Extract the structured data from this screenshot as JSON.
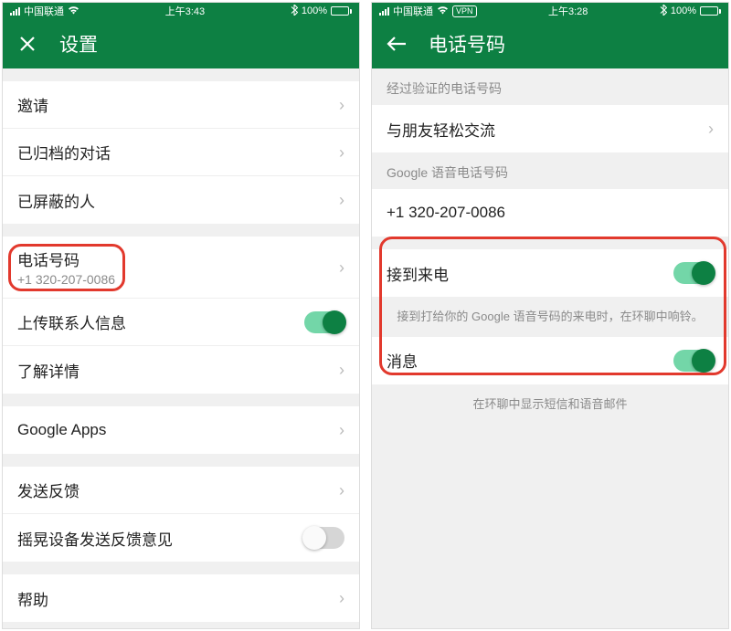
{
  "left": {
    "status": {
      "carrier": "中国联通",
      "time": "上午3:43",
      "bluetooth": "✱",
      "battery_pct": "100%"
    },
    "title": "设置",
    "items": {
      "invite": "邀请",
      "archived": "已归档的对话",
      "blocked": "已屏蔽的人",
      "phone_title": "电话号码",
      "phone_sub": "+1 320-207-0086",
      "upload_contacts": "上传联系人信息",
      "learn_more": "了解详情",
      "google_apps": "Google Apps",
      "feedback": "发送反馈",
      "shake_feedback": "摇晃设备发送反馈意见",
      "help": "帮助"
    }
  },
  "right": {
    "status": {
      "carrier": "中国联通",
      "vpn": "VPN",
      "time": "上午3:28",
      "bluetooth": "✱",
      "battery_pct": "100%"
    },
    "title": "电话号码",
    "section_verified": "经过验证的电话号码",
    "share_friends": "与朋友轻松交流",
    "section_google_voice": "Google 语音电话号码",
    "google_voice_number": "+1 320-207-0086",
    "incoming_calls": "接到来电",
    "incoming_calls_desc": "接到打给你的 Google 语音号码的来电时，在环聊中响铃。",
    "messages": "消息",
    "messages_desc": "在环聊中显示短信和语音邮件"
  }
}
